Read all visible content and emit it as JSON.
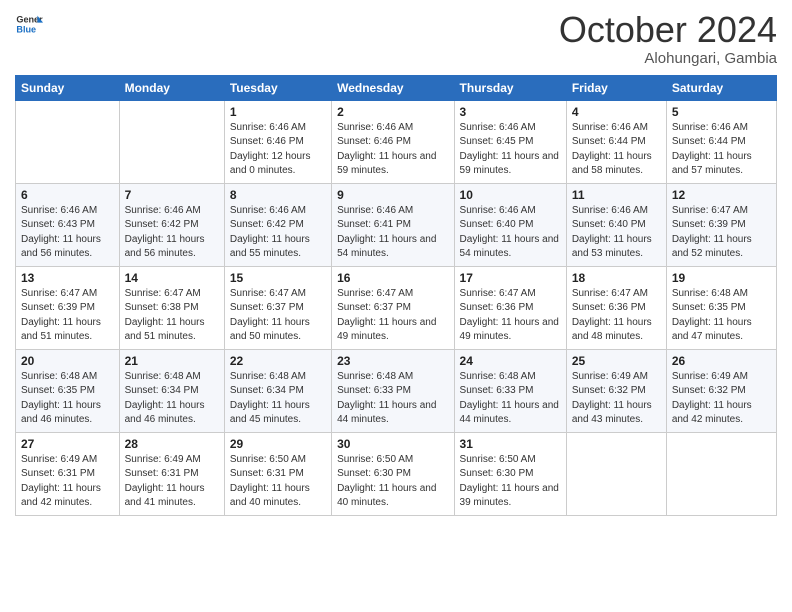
{
  "logo": {
    "line1": "General",
    "line2": "Blue"
  },
  "title": "October 2024",
  "subtitle": "Alohungari, Gambia",
  "days_header": [
    "Sunday",
    "Monday",
    "Tuesday",
    "Wednesday",
    "Thursday",
    "Friday",
    "Saturday"
  ],
  "weeks": [
    [
      {
        "num": "",
        "detail": ""
      },
      {
        "num": "",
        "detail": ""
      },
      {
        "num": "1",
        "detail": "Sunrise: 6:46 AM\nSunset: 6:46 PM\nDaylight: 12 hours\nand 0 minutes."
      },
      {
        "num": "2",
        "detail": "Sunrise: 6:46 AM\nSunset: 6:46 PM\nDaylight: 11 hours\nand 59 minutes."
      },
      {
        "num": "3",
        "detail": "Sunrise: 6:46 AM\nSunset: 6:45 PM\nDaylight: 11 hours\nand 59 minutes."
      },
      {
        "num": "4",
        "detail": "Sunrise: 6:46 AM\nSunset: 6:44 PM\nDaylight: 11 hours\nand 58 minutes."
      },
      {
        "num": "5",
        "detail": "Sunrise: 6:46 AM\nSunset: 6:44 PM\nDaylight: 11 hours\nand 57 minutes."
      }
    ],
    [
      {
        "num": "6",
        "detail": "Sunrise: 6:46 AM\nSunset: 6:43 PM\nDaylight: 11 hours\nand 56 minutes."
      },
      {
        "num": "7",
        "detail": "Sunrise: 6:46 AM\nSunset: 6:42 PM\nDaylight: 11 hours\nand 56 minutes."
      },
      {
        "num": "8",
        "detail": "Sunrise: 6:46 AM\nSunset: 6:42 PM\nDaylight: 11 hours\nand 55 minutes."
      },
      {
        "num": "9",
        "detail": "Sunrise: 6:46 AM\nSunset: 6:41 PM\nDaylight: 11 hours\nand 54 minutes."
      },
      {
        "num": "10",
        "detail": "Sunrise: 6:46 AM\nSunset: 6:40 PM\nDaylight: 11 hours\nand 54 minutes."
      },
      {
        "num": "11",
        "detail": "Sunrise: 6:46 AM\nSunset: 6:40 PM\nDaylight: 11 hours\nand 53 minutes."
      },
      {
        "num": "12",
        "detail": "Sunrise: 6:47 AM\nSunset: 6:39 PM\nDaylight: 11 hours\nand 52 minutes."
      }
    ],
    [
      {
        "num": "13",
        "detail": "Sunrise: 6:47 AM\nSunset: 6:39 PM\nDaylight: 11 hours\nand 51 minutes."
      },
      {
        "num": "14",
        "detail": "Sunrise: 6:47 AM\nSunset: 6:38 PM\nDaylight: 11 hours\nand 51 minutes."
      },
      {
        "num": "15",
        "detail": "Sunrise: 6:47 AM\nSunset: 6:37 PM\nDaylight: 11 hours\nand 50 minutes."
      },
      {
        "num": "16",
        "detail": "Sunrise: 6:47 AM\nSunset: 6:37 PM\nDaylight: 11 hours\nand 49 minutes."
      },
      {
        "num": "17",
        "detail": "Sunrise: 6:47 AM\nSunset: 6:36 PM\nDaylight: 11 hours\nand 49 minutes."
      },
      {
        "num": "18",
        "detail": "Sunrise: 6:47 AM\nSunset: 6:36 PM\nDaylight: 11 hours\nand 48 minutes."
      },
      {
        "num": "19",
        "detail": "Sunrise: 6:48 AM\nSunset: 6:35 PM\nDaylight: 11 hours\nand 47 minutes."
      }
    ],
    [
      {
        "num": "20",
        "detail": "Sunrise: 6:48 AM\nSunset: 6:35 PM\nDaylight: 11 hours\nand 46 minutes."
      },
      {
        "num": "21",
        "detail": "Sunrise: 6:48 AM\nSunset: 6:34 PM\nDaylight: 11 hours\nand 46 minutes."
      },
      {
        "num": "22",
        "detail": "Sunrise: 6:48 AM\nSunset: 6:34 PM\nDaylight: 11 hours\nand 45 minutes."
      },
      {
        "num": "23",
        "detail": "Sunrise: 6:48 AM\nSunset: 6:33 PM\nDaylight: 11 hours\nand 44 minutes."
      },
      {
        "num": "24",
        "detail": "Sunrise: 6:48 AM\nSunset: 6:33 PM\nDaylight: 11 hours\nand 44 minutes."
      },
      {
        "num": "25",
        "detail": "Sunrise: 6:49 AM\nSunset: 6:32 PM\nDaylight: 11 hours\nand 43 minutes."
      },
      {
        "num": "26",
        "detail": "Sunrise: 6:49 AM\nSunset: 6:32 PM\nDaylight: 11 hours\nand 42 minutes."
      }
    ],
    [
      {
        "num": "27",
        "detail": "Sunrise: 6:49 AM\nSunset: 6:31 PM\nDaylight: 11 hours\nand 42 minutes."
      },
      {
        "num": "28",
        "detail": "Sunrise: 6:49 AM\nSunset: 6:31 PM\nDaylight: 11 hours\nand 41 minutes."
      },
      {
        "num": "29",
        "detail": "Sunrise: 6:50 AM\nSunset: 6:31 PM\nDaylight: 11 hours\nand 40 minutes."
      },
      {
        "num": "30",
        "detail": "Sunrise: 6:50 AM\nSunset: 6:30 PM\nDaylight: 11 hours\nand 40 minutes."
      },
      {
        "num": "31",
        "detail": "Sunrise: 6:50 AM\nSunset: 6:30 PM\nDaylight: 11 hours\nand 39 minutes."
      },
      {
        "num": "",
        "detail": ""
      },
      {
        "num": "",
        "detail": ""
      }
    ]
  ]
}
